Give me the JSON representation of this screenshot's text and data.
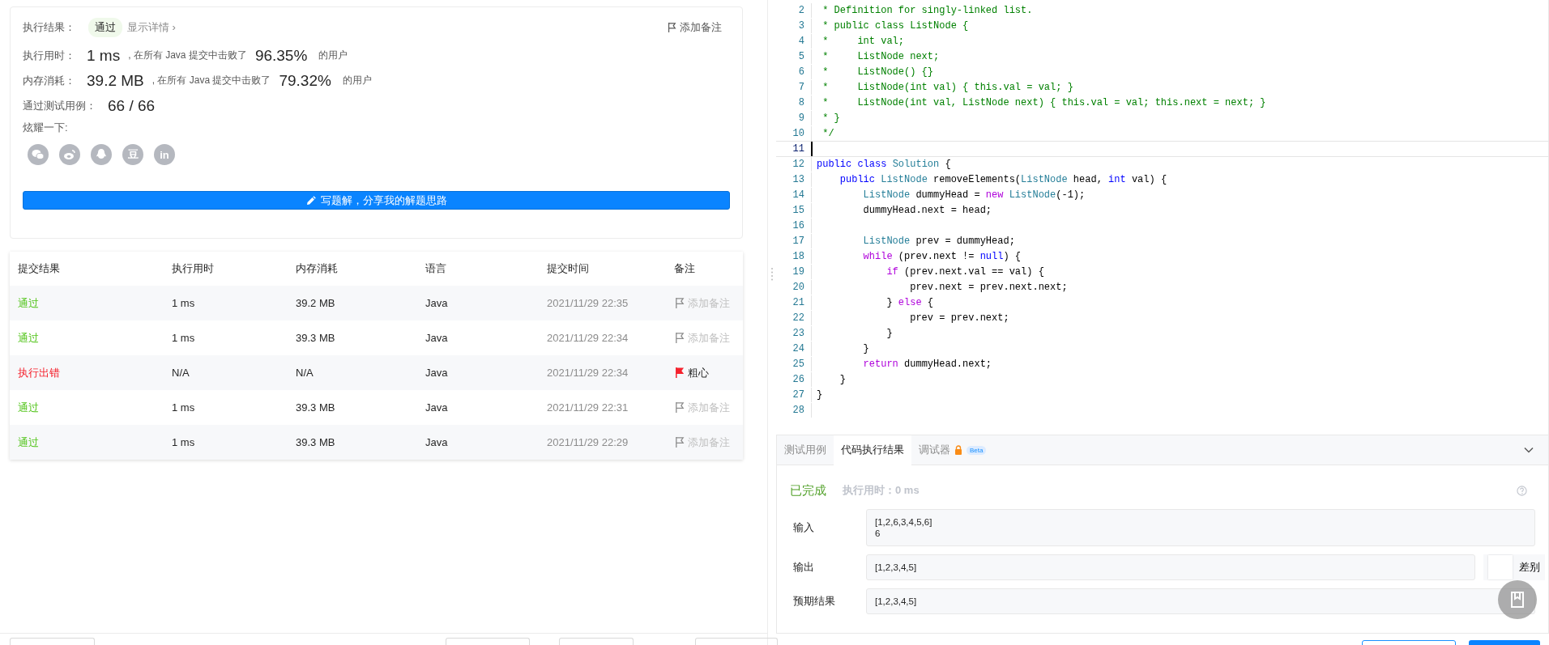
{
  "result_card": {
    "label": "执行结果：",
    "status": "通过",
    "details_link": "显示详情 ›",
    "add_note": "添加备注",
    "stats": [
      {
        "label": "执行用时：",
        "value": "1 ms",
        "middle": ", 在所有 Java 提交中击败了",
        "percent": "96.35%",
        "suffix": "的用户"
      },
      {
        "label": "内存消耗：",
        "value": "39.2 MB",
        "middle": ", 在所有 Java 提交中击败了",
        "percent": "79.32%",
        "suffix": "的用户"
      }
    ],
    "tests_label": "通过测试用例：",
    "tests_value": "66 / 66",
    "share_label": "炫耀一下:",
    "share_icons": [
      {
        "kind": "chat"
      },
      {
        "kind": "swirl"
      },
      {
        "kind": "penguin"
      },
      {
        "kind": "glyph",
        "text": "豆"
      },
      {
        "kind": "glyph",
        "text": "in"
      }
    ],
    "write_button": "写题解，分享我的解题思路"
  },
  "submissions": {
    "columns": [
      "提交结果",
      "执行用时",
      "内存消耗",
      "语言",
      "提交时间",
      "备注"
    ],
    "rows": [
      {
        "status": "通过",
        "kind": "passed",
        "time": "1 ms",
        "memory": "39.2 MB",
        "language": "Java",
        "submitted": "2021/11/29 22:35",
        "note": "添加备注",
        "noted": false
      },
      {
        "status": "通过",
        "kind": "passed",
        "time": "1 ms",
        "memory": "39.3 MB",
        "language": "Java",
        "submitted": "2021/11/29 22:34",
        "note": "添加备注",
        "noted": false
      },
      {
        "status": "执行出错",
        "kind": "error",
        "time": "N/A",
        "memory": "N/A",
        "language": "Java",
        "submitted": "2021/11/29 22:34",
        "note": "粗心",
        "noted": true
      },
      {
        "status": "通过",
        "kind": "passed",
        "time": "1 ms",
        "memory": "39.3 MB",
        "language": "Java",
        "submitted": "2021/11/29 22:31",
        "note": "添加备注",
        "noted": false
      },
      {
        "status": "通过",
        "kind": "passed",
        "time": "1 ms",
        "memory": "39.3 MB",
        "language": "Java",
        "submitted": "2021/11/29 22:29",
        "note": "添加备注",
        "noted": false
      }
    ]
  },
  "editor": {
    "lines": [
      {
        "number": "2",
        "current": false,
        "tokens": [
          {
            "kind": "comment",
            "text": " * Definition for singly-linked list."
          }
        ]
      },
      {
        "number": "3",
        "current": false,
        "tokens": [
          {
            "kind": "comment",
            "text": " * public class ListNode {"
          }
        ]
      },
      {
        "number": "4",
        "current": false,
        "tokens": [
          {
            "kind": "comment",
            "text": " *     int val;"
          }
        ]
      },
      {
        "number": "5",
        "current": false,
        "tokens": [
          {
            "kind": "comment",
            "text": " *     ListNode next;"
          }
        ]
      },
      {
        "number": "6",
        "current": false,
        "tokens": [
          {
            "kind": "comment",
            "text": " *     ListNode() {}"
          }
        ]
      },
      {
        "number": "7",
        "current": false,
        "tokens": [
          {
            "kind": "comment",
            "text": " *     ListNode(int val) { this.val = val; }"
          }
        ]
      },
      {
        "number": "8",
        "current": false,
        "tokens": [
          {
            "kind": "comment",
            "text": " *     ListNode(int val, ListNode next) { this.val = val; this.next = next; }"
          }
        ]
      },
      {
        "number": "9",
        "current": false,
        "tokens": [
          {
            "kind": "comment",
            "text": " * }"
          }
        ]
      },
      {
        "number": "10",
        "current": false,
        "tokens": [
          {
            "kind": "comment",
            "text": " */"
          }
        ]
      },
      {
        "number": "11",
        "current": true
      },
      {
        "number": "12",
        "current": false,
        "tokens": [
          {
            "kind": "keyword",
            "text": "public"
          },
          {
            "kind": "keyword",
            "text": " class"
          },
          {
            "kind": "type",
            "text": " Solution"
          },
          {
            "kind": "plain",
            "text": " {"
          }
        ]
      },
      {
        "number": "13",
        "current": false,
        "tokens": [
          {
            "kind": "keyword",
            "text": "    public"
          },
          {
            "kind": "type",
            "text": " ListNode"
          },
          {
            "kind": "plain",
            "text": " removeElements("
          },
          {
            "kind": "type",
            "text": "ListNode"
          },
          {
            "kind": "plain",
            "text": " head, "
          },
          {
            "kind": "keyword",
            "text": "int"
          },
          {
            "kind": "plain",
            "text": " val) {"
          }
        ]
      },
      {
        "number": "14",
        "current": false,
        "tokens": [
          {
            "kind": "type",
            "text": "        ListNode"
          },
          {
            "kind": "plain",
            "text": " dummyHead = "
          },
          {
            "kind": "control",
            "text": "new"
          },
          {
            "kind": "type",
            "text": " ListNode"
          },
          {
            "kind": "plain",
            "text": "(-1);"
          }
        ]
      },
      {
        "number": "15",
        "current": false,
        "tokens": [
          {
            "kind": "plain",
            "text": "        dummyHead.next = head;"
          }
        ]
      },
      {
        "number": "16",
        "current": false
      },
      {
        "number": "17",
        "current": false,
        "tokens": [
          {
            "kind": "type",
            "text": "        ListNode"
          },
          {
            "kind": "plain",
            "text": " prev = dummyHead;"
          }
        ]
      },
      {
        "number": "18",
        "current": false,
        "tokens": [
          {
            "kind": "control",
            "text": "        while"
          },
          {
            "kind": "plain",
            "text": " (prev.next != "
          },
          {
            "kind": "keyword",
            "text": "null"
          },
          {
            "kind": "plain",
            "text": ") {"
          }
        ]
      },
      {
        "number": "19",
        "current": false,
        "tokens": [
          {
            "kind": "control",
            "text": "            if"
          },
          {
            "kind": "plain",
            "text": " (prev.next.val == val) {"
          }
        ]
      },
      {
        "number": "20",
        "current": false,
        "tokens": [
          {
            "kind": "plain",
            "text": "                prev.next = prev.next.next;"
          }
        ]
      },
      {
        "number": "21",
        "current": false,
        "tokens": [
          {
            "kind": "plain",
            "text": "            } "
          },
          {
            "kind": "control",
            "text": "else"
          },
          {
            "kind": "plain",
            "text": " {"
          }
        ]
      },
      {
        "number": "22",
        "current": false,
        "tokens": [
          {
            "kind": "plain",
            "text": "                prev = prev.next;"
          }
        ]
      },
      {
        "number": "23",
        "current": false,
        "tokens": [
          {
            "kind": "plain",
            "text": "            }"
          }
        ]
      },
      {
        "number": "24",
        "current": false,
        "tokens": [
          {
            "kind": "plain",
            "text": "        }"
          }
        ]
      },
      {
        "number": "25",
        "current": false,
        "tokens": [
          {
            "kind": "control",
            "text": "        return"
          },
          {
            "kind": "plain",
            "text": " dummyHead.next;"
          }
        ]
      },
      {
        "number": "26",
        "current": false,
        "tokens": [
          {
            "kind": "plain",
            "text": "    }"
          }
        ]
      },
      {
        "number": "27",
        "current": false,
        "tokens": [
          {
            "kind": "plain",
            "text": "}"
          }
        ]
      },
      {
        "number": "28",
        "current": false
      }
    ]
  },
  "console": {
    "tabs": [
      {
        "label": "测试用例",
        "selected": false
      },
      {
        "label": "代码执行结果",
        "selected": true
      },
      {
        "label": "调试器",
        "selected": false,
        "locked": true,
        "badge": "Beta"
      }
    ],
    "status": "已完成",
    "runtime": "执行用时：0 ms",
    "fields": [
      {
        "label": "输入",
        "value": "[1,2,6,3,4,5,6]\n6"
      },
      {
        "label": "输出",
        "value": "[1,2,3,4,5]",
        "diff": "差别"
      },
      {
        "label": "预期结果",
        "value": "[1,2,3,4,5]"
      }
    ]
  }
}
